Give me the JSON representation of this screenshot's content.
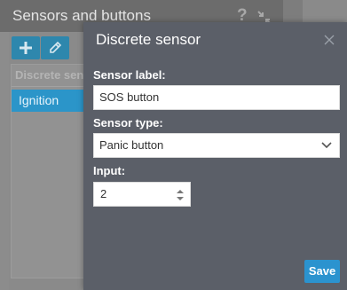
{
  "background_panel": {
    "title": "Sensors and buttons",
    "help_glyph": "?",
    "add_icon": "plus-icon",
    "edit_icon": "pencil-icon",
    "column_header": "Discrete sensors",
    "selected_row": "Ignition"
  },
  "dialog": {
    "title": "Discrete sensor",
    "close_icon": "close-icon",
    "sensor_label": {
      "label": "Sensor label:",
      "value": "SOS button"
    },
    "sensor_type": {
      "label": "Sensor type:",
      "value": "Panic button"
    },
    "input": {
      "label": "Input:",
      "value": "2"
    },
    "save_label": "Save"
  },
  "colors": {
    "dialog_bg": "#5b5f68",
    "accent": "#2b93cf"
  }
}
